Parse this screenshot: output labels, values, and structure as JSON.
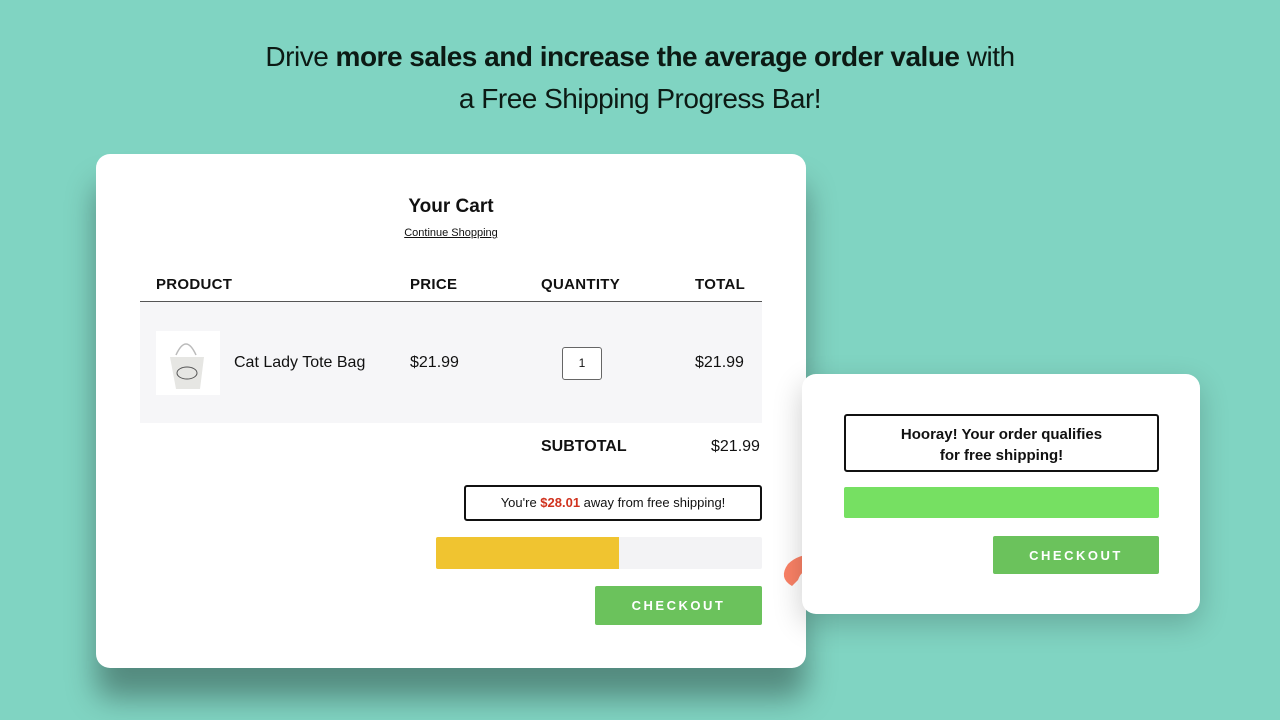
{
  "headline": {
    "pre": "Drive ",
    "bold": "more sales and increase the average order value",
    "post": " with",
    "line2": "a Free Shipping Progress Bar!"
  },
  "cart": {
    "title": "Your Cart",
    "continue": "Continue Shopping",
    "columns": [
      "PRODUCT",
      "PRICE",
      "QUANTITY",
      "TOTAL"
    ],
    "items": [
      {
        "name": "Cat Lady Tote Bag",
        "price": "$21.99",
        "quantity": "1",
        "total": "$21.99",
        "image": "tote-bag-image"
      }
    ],
    "subtotal_label": "SUBTOTAL",
    "subtotal": "$21.99",
    "notice_pre": "You're ",
    "notice_amount": "$28.01",
    "notice_post": " away from free shipping!",
    "progress_percent": 56,
    "progress_color": "#f0c430",
    "checkout": "CHECKOUT"
  },
  "qualified": {
    "line1": "Hooray! Your order qualifies",
    "line2": "for free shipping!",
    "progress_percent": 100,
    "progress_color": "#76e062",
    "checkout": "CHECKOUT"
  },
  "arrow": {
    "icon": "curved-arrow-right-icon",
    "color": "#fb8266"
  }
}
